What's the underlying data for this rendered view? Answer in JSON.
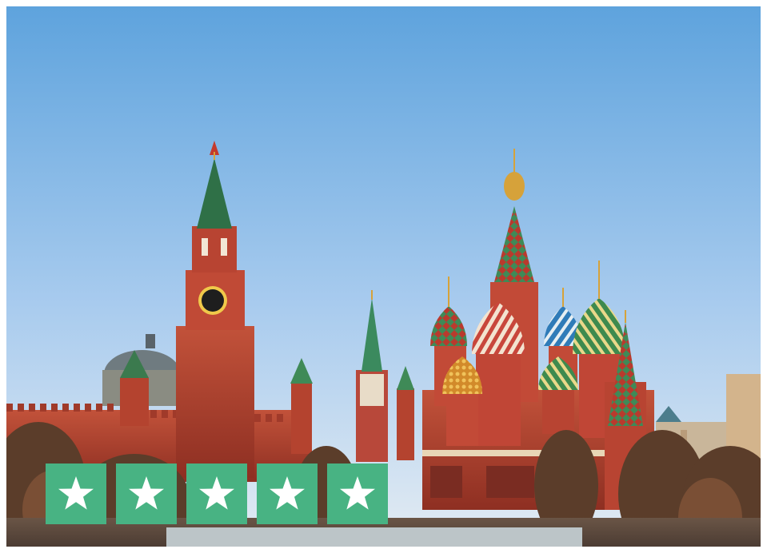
{
  "photo": {
    "subject": "moscow-red-square-kremlin-st-basils-cathedral"
  },
  "rating": {
    "stars_filled": 5,
    "stars_total": 5,
    "tile_color": "#48b383",
    "star_color": "#ffffff",
    "star_icon": "star-icon"
  },
  "palette": {
    "sky_top": "#5ea3dd",
    "sky_bottom": "#dfe9f3",
    "brick_red": "#b4432f",
    "spire_green": "#3f8a57",
    "gold": "#d6a23a"
  }
}
